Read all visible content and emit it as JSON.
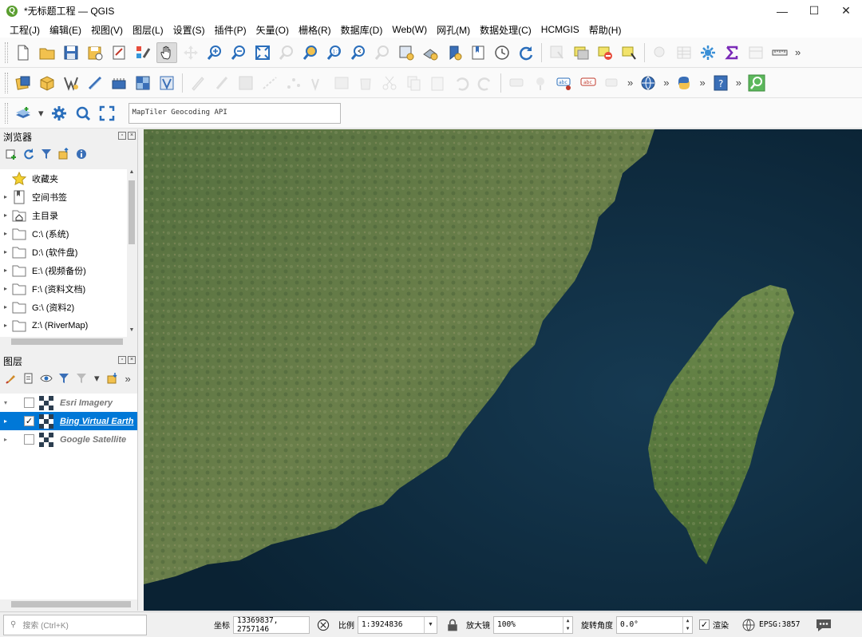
{
  "window": {
    "title": "*无标题工程 — QGIS",
    "minimize": "—",
    "maximize": "☐",
    "close": "✕"
  },
  "menu": [
    "工程(J)",
    "编辑(E)",
    "视图(V)",
    "图层(L)",
    "设置(S)",
    "插件(P)",
    "矢量(O)",
    "栅格(R)",
    "数据库(D)",
    "Web(W)",
    "网孔(M)",
    "数据处理(C)",
    "HCMGIS",
    "帮助(H)"
  ],
  "toolbar3": {
    "geocoder_placeholder": "MapTiler Geocoding API"
  },
  "browser_panel": {
    "title": "浏览器",
    "items": [
      {
        "label": "收藏夹",
        "icon": "star-icon",
        "expandable": false
      },
      {
        "label": "空间书签",
        "icon": "bookmark-icon",
        "expandable": true
      },
      {
        "label": "主目录",
        "icon": "home-folder-icon",
        "expandable": true
      },
      {
        "label": "C:\\ (系统)",
        "icon": "folder-icon",
        "expandable": true
      },
      {
        "label": "D:\\ (软件盘)",
        "icon": "folder-icon",
        "expandable": true
      },
      {
        "label": "E:\\ (视频备份)",
        "icon": "folder-icon",
        "expandable": true
      },
      {
        "label": "F:\\ (资料文档)",
        "icon": "folder-icon",
        "expandable": true
      },
      {
        "label": "G:\\ (资料2)",
        "icon": "folder-icon",
        "expandable": true
      },
      {
        "label": "Z:\\ (RiverMap)",
        "icon": "folder-icon",
        "expandable": true
      }
    ]
  },
  "layers_panel": {
    "title": "图层",
    "layers": [
      {
        "name": "Esri Imagery",
        "checked": false,
        "selected": false,
        "expanded": true
      },
      {
        "name": "Bing Virtual Earth",
        "checked": true,
        "selected": true,
        "expanded": false
      },
      {
        "name": "Google Satellite",
        "checked": false,
        "selected": false,
        "expanded": false
      }
    ]
  },
  "statusbar": {
    "search_placeholder": "搜索 (Ctrl+K)",
    "coordinate_label": "坐标",
    "coordinate_value": "13369837, 2757146",
    "scale_label": "比例",
    "scale_value": "1:3924836",
    "magnifier_label": "放大镜",
    "magnifier_value": "100%",
    "rotation_label": "旋转角度",
    "rotation_value": "0.0°",
    "render_label": "渲染",
    "render_checked": true,
    "crs": "EPSG:3857"
  },
  "colors": {
    "selection": "#0078d7",
    "sea": "#0e2a3d",
    "land": "#4f6b3a",
    "qgis_green": "#5a9e2f"
  }
}
